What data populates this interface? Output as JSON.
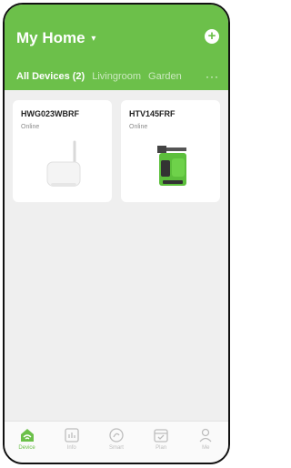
{
  "header": {
    "home_title": "My Home",
    "chevron_glyph": "▾",
    "add_glyph": "+"
  },
  "tabs": {
    "all_devices": "All Devices (2)",
    "livingroom": "Livingroom",
    "garden": "Garden",
    "more_glyph": "···"
  },
  "devices": [
    {
      "name": "HWG023WBRF",
      "status": "Online",
      "icon": "gateway-device-icon"
    },
    {
      "name": "HTV145FRF",
      "status": "Online",
      "icon": "water-timer-device-icon"
    }
  ],
  "bottom_nav": [
    {
      "label": "Device",
      "icon": "home-wifi-icon",
      "active": true
    },
    {
      "label": "Info",
      "icon": "info-chart-icon",
      "active": false
    },
    {
      "label": "Smart",
      "icon": "smart-swirl-icon",
      "active": false
    },
    {
      "label": "Plan",
      "icon": "calendar-check-icon",
      "active": false
    },
    {
      "label": "Me",
      "icon": "person-icon",
      "active": false
    }
  ],
  "colors": {
    "brand_green": "#6cc04a",
    "background": "#efefef",
    "inactive_nav": "#bdbdbd"
  }
}
